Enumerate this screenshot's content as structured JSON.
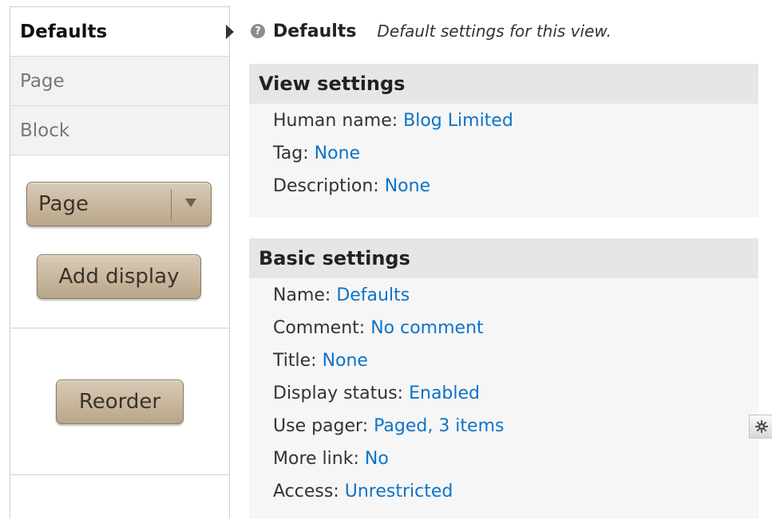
{
  "sidebar": {
    "tabs": [
      {
        "label": "Defaults",
        "active": true
      },
      {
        "label": "Page",
        "active": false
      },
      {
        "label": "Block",
        "active": false
      }
    ],
    "display_select": {
      "selected": "Page"
    },
    "add_display_label": "Add display",
    "reorder_label": "Reorder"
  },
  "header": {
    "title": "Defaults",
    "description": "Default settings for this view."
  },
  "view_settings": {
    "title": "View settings",
    "rows": [
      {
        "label": "Human name:",
        "value": "Blog Limited"
      },
      {
        "label": "Tag:",
        "value": "None"
      },
      {
        "label": "Description:",
        "value": "None"
      }
    ]
  },
  "basic_settings": {
    "title": "Basic settings",
    "rows": [
      {
        "label": "Name:",
        "value": "Defaults"
      },
      {
        "label": "Comment:",
        "value": "No comment"
      },
      {
        "label": "Title:",
        "value": "None"
      },
      {
        "label": "Display status:",
        "value": "Enabled"
      },
      {
        "label": "Use pager:",
        "value": "Paged, 3 items"
      },
      {
        "label": "More link:",
        "value": "No"
      },
      {
        "label": "Access:",
        "value": "Unrestricted"
      }
    ]
  },
  "colors": {
    "link": "#0d73c8",
    "button_tan": "#c8b89f",
    "panel_bg": "#f6f6f6",
    "panel_title_bg": "#e6e6e6"
  },
  "icons": {
    "help": "help-icon",
    "gear": "gear-icon",
    "active_tab": "caret-right-icon",
    "select": "triangle-down-icon"
  }
}
